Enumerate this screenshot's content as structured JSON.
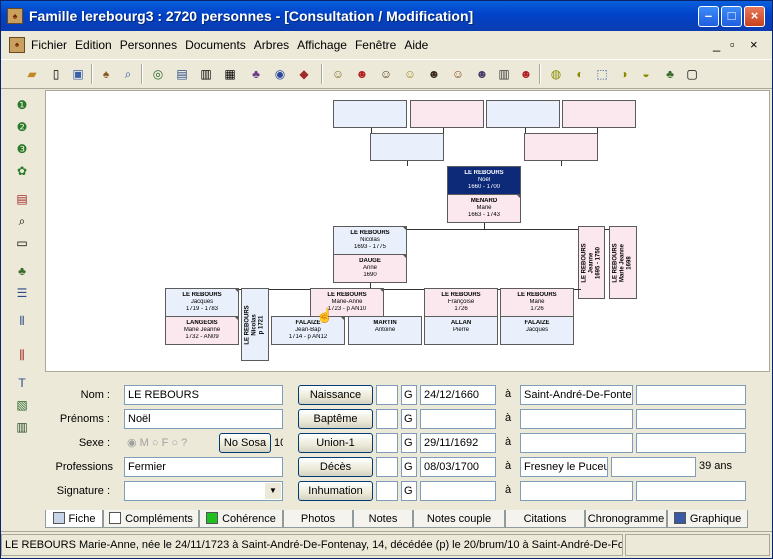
{
  "window": {
    "title": "Famille lerebourg3 : 2720 personnes - [Consultation / Modification]"
  },
  "menu": {
    "items": [
      "Fichier",
      "Edition",
      "Personnes",
      "Documents",
      "Arbres",
      "Affichage",
      "Fenêtre",
      "Aide"
    ]
  },
  "tree": {
    "main": {
      "name": "LE REBOURS",
      "first": "Noël",
      "dates": "1660 - 1700"
    },
    "spouse": {
      "name": "MENARD",
      "first": "Marie",
      "dates": "1663 - 1743"
    },
    "child1": {
      "name": "LE REBOURS",
      "first": "Nicolas",
      "dates": "1693 - 1775"
    },
    "child1_spouse": {
      "name": "DAUGE",
      "first": "Anne",
      "dates": "1690"
    },
    "vchild_a": {
      "name": "LE REBOURS",
      "first": "Jeanne",
      "dates": "1695 - 1750"
    },
    "vchild_b": {
      "name": "LE REBOURS",
      "first": "Marie Jeanne",
      "dates": "1698"
    },
    "g1": {
      "name": "LE REBOURS",
      "first": "Jacques",
      "dates": "1719 - 1783"
    },
    "g1_spouse": {
      "name": "LANGEOIS",
      "first": "Marie Jeanne",
      "dates": "1732 - AN09"
    },
    "vg": {
      "name": "LE REBOURS",
      "first": "Nicolas",
      "dates": "p 1721"
    },
    "g2": {
      "name": "LE REBOURS",
      "first": "Marie-Anne",
      "dates": "1723 - p AN10"
    },
    "g2_spouse_a": {
      "name": "FALAIZE",
      "first": "Jean-Bap",
      "dates": "1714 - p AN12"
    },
    "g2_spouse_b": {
      "name": "MARTIN",
      "first": "Antoine",
      "dates": ""
    },
    "g3": {
      "name": "LE REBOURS",
      "first": "Françoise",
      "dates": "1726"
    },
    "g3_spouse": {
      "name": "ALLAN",
      "first": "Pierre",
      "dates": ""
    },
    "g4": {
      "name": "LE REBOURS",
      "first": "Marie",
      "dates": "1726"
    },
    "g4_spouse": {
      "name": "FALAIZE",
      "first": "Jacques",
      "dates": ""
    }
  },
  "form": {
    "nom_label": "Nom :",
    "nom": "LE REBOURS",
    "prenoms_label": "Prénoms :",
    "prenoms": "Noël",
    "sexe_label": "Sexe :",
    "sexe_m": "M",
    "sexe_f": "F",
    "sexe_q": "?",
    "nososa": "No Sosa",
    "nososa_val": "10",
    "professions_label": "Professions",
    "professions": "Fermier",
    "signature_label": "Signature :",
    "naissance": "Naissance",
    "bapteme": "Baptême",
    "union": "Union-1",
    "deces": "Décès",
    "inhumation": "Inhumation",
    "g": "G",
    "a": "à",
    "naissance_date": "24/12/1660",
    "naissance_place": "Saint-André-De-Fonte",
    "union_date": "29/11/1692",
    "deces_date": "08/03/1700",
    "deces_place": "Fresney le Puceu",
    "age": "39 ans"
  },
  "tabs": [
    "Fiche",
    "Compléments",
    "Cohérence",
    "Photos",
    "Notes",
    "Notes couple",
    "Citations",
    "Chronogramme",
    "Graphique"
  ],
  "status": "LE REBOURS Marie-Anne, née le 24/11/1723 à Saint-André-De-Fontenay, 14, décédée (p)  le 20/brum/10 à Saint-André-De-Fo",
  "colors": {
    "title_blue": "#0042c8",
    "male_box": "#e9f0fb",
    "female_box": "#fbe8ef",
    "selected": "#0d2a78"
  }
}
